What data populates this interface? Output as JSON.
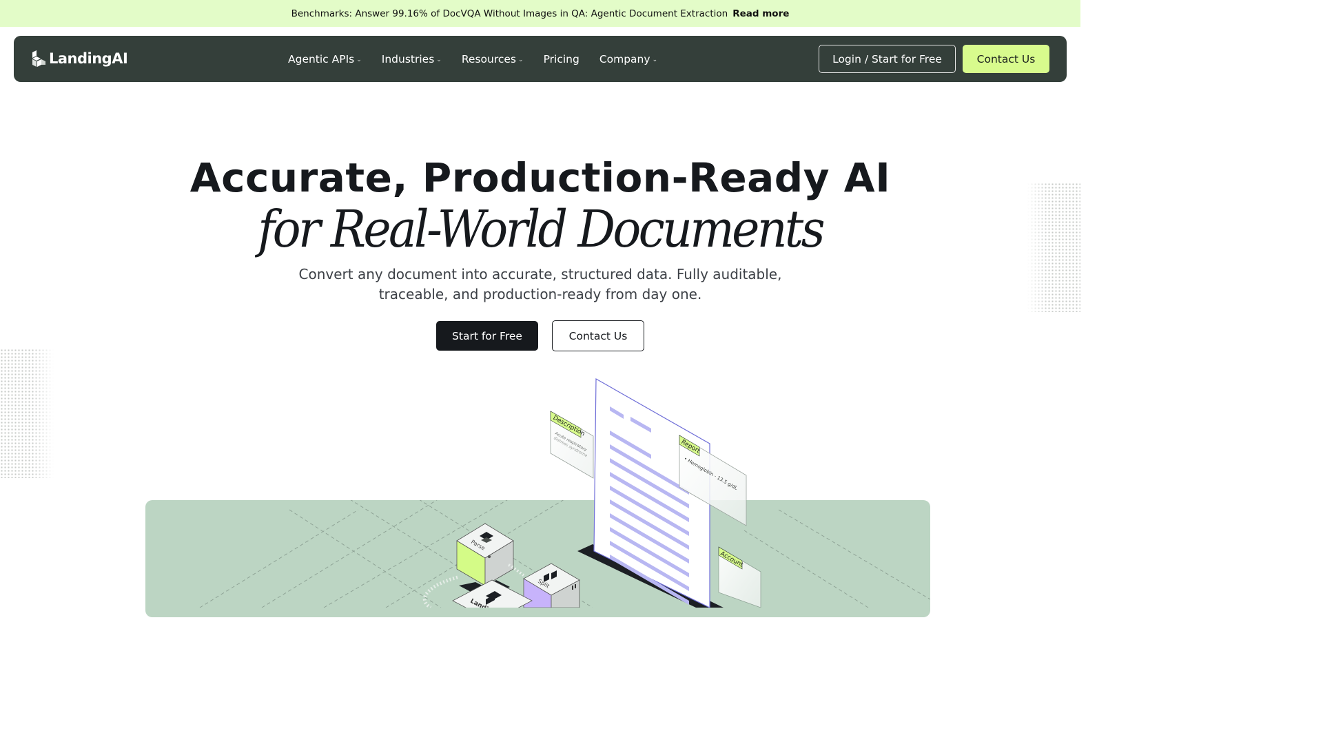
{
  "banner": {
    "text": "Benchmarks: Answer 99.16% of DocVQA Without Images in QA: Agentic Document Extraction",
    "link": "Read more"
  },
  "nav": {
    "logo": "LandingAI",
    "items": [
      {
        "label": "Agentic APIs",
        "dropdown": true
      },
      {
        "label": "Industries",
        "dropdown": true
      },
      {
        "label": "Resources",
        "dropdown": true
      },
      {
        "label": "Pricing",
        "dropdown": false
      },
      {
        "label": "Company",
        "dropdown": true
      }
    ],
    "login": "Login / Start for Free",
    "contact": "Contact Us"
  },
  "hero": {
    "title": "Accurate, Production-Ready AI",
    "subtitle": "for Real-World Documents",
    "description": "Convert any document into accurate, structured data. Fully auditable, traceable, and production-ready from day one.",
    "cta_primary": "Start for Free",
    "cta_secondary": "Contact Us"
  },
  "illustration": {
    "tags": {
      "description": "Description",
      "description_text_1": "Acute respiratory",
      "description_text_2": "distress syndrome",
      "report": "Report",
      "report_text": "• Hemoglobin - 13.5 g/dL",
      "account": "Account"
    },
    "blocks": {
      "parse": "Parse",
      "split": "Split",
      "landing": "Landing"
    }
  },
  "colors": {
    "banner_bg": "#e3fcc8",
    "nav_bg": "#343f3a",
    "accent": "#d8fb8d",
    "stage_bg": "#bcd5c3",
    "dark": "#16191d",
    "purple": "#6f6ed8"
  }
}
